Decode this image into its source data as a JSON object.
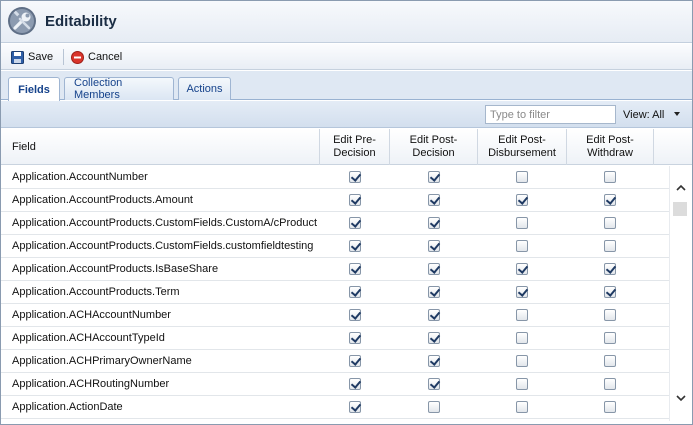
{
  "window": {
    "title": "Editability",
    "icon": "wrench-icon"
  },
  "toolbar": {
    "save_label": "Save",
    "cancel_label": "Cancel"
  },
  "tabs": [
    {
      "label": "Fields",
      "active": true
    },
    {
      "label": "Collection Members",
      "active": false
    },
    {
      "label": "Actions",
      "active": false
    }
  ],
  "filter": {
    "placeholder": "Type to filter",
    "value": ""
  },
  "view": {
    "label": "View: All"
  },
  "columns": {
    "field": "Field",
    "c1": [
      "Edit Pre-",
      "Decision"
    ],
    "c2": [
      "Edit Post-",
      "Decision"
    ],
    "c3": [
      "Edit Post-",
      "Disbursement"
    ],
    "c4": [
      "Edit Post-",
      "Withdraw"
    ]
  },
  "rows": [
    {
      "field": "Application.AccountNumber",
      "checks": [
        true,
        true,
        false,
        false
      ]
    },
    {
      "field": "Application.AccountProducts.Amount",
      "checks": [
        true,
        true,
        true,
        true
      ]
    },
    {
      "field": "Application.AccountProducts.CustomFields.CustomA/cProduct",
      "checks": [
        true,
        true,
        false,
        false
      ]
    },
    {
      "field": "Application.AccountProducts.CustomFields.customfieldtesting",
      "checks": [
        true,
        true,
        false,
        false
      ]
    },
    {
      "field": "Application.AccountProducts.IsBaseShare",
      "checks": [
        true,
        true,
        true,
        true
      ]
    },
    {
      "field": "Application.AccountProducts.Term",
      "checks": [
        true,
        true,
        true,
        true
      ]
    },
    {
      "field": "Application.ACHAccountNumber",
      "checks": [
        true,
        true,
        false,
        false
      ]
    },
    {
      "field": "Application.ACHAccountTypeId",
      "checks": [
        true,
        true,
        false,
        false
      ]
    },
    {
      "field": "Application.ACHPrimaryOwnerName",
      "checks": [
        true,
        true,
        false,
        false
      ]
    },
    {
      "field": "Application.ACHRoutingNumber",
      "checks": [
        true,
        true,
        false,
        false
      ]
    },
    {
      "field": "Application.ActionDate",
      "checks": [
        true,
        false,
        false,
        false
      ]
    }
  ]
}
